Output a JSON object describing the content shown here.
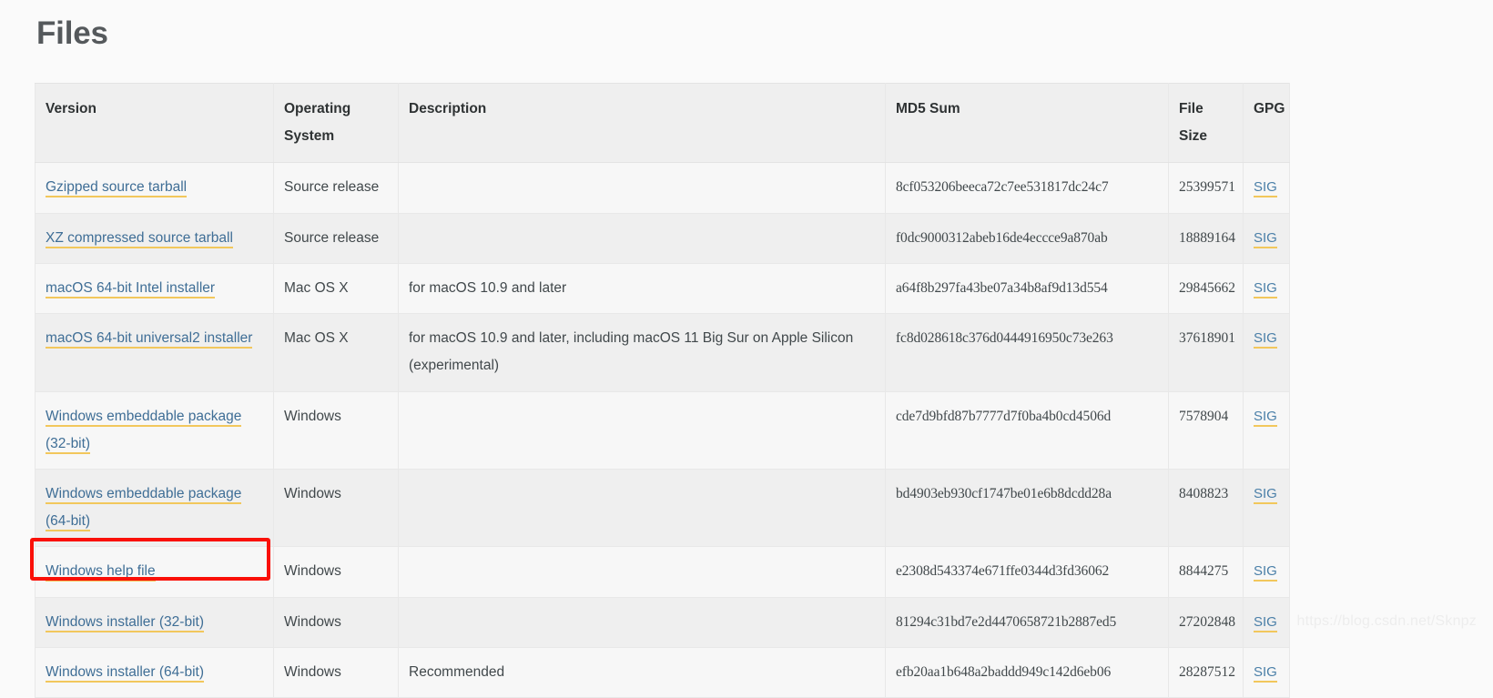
{
  "page": {
    "title": "Files",
    "watermark": "https://blog.csdn.net/Sknpz"
  },
  "table": {
    "headers": {
      "version": "Version",
      "os": "Operating System",
      "description": "Description",
      "md5": "MD5 Sum",
      "filesize": "File Size",
      "gpg": "GPG"
    },
    "rows": [
      {
        "version": "Gzipped source tarball",
        "os": "Source release",
        "description": "",
        "md5": "8cf053206beeca72c7ee531817dc24c7",
        "filesize": "25399571",
        "gpg": "SIG",
        "highlighted": false
      },
      {
        "version": "XZ compressed source tarball",
        "os": "Source release",
        "description": "",
        "md5": "f0dc9000312abeb16de4eccce9a870ab",
        "filesize": "18889164",
        "gpg": "SIG",
        "highlighted": false
      },
      {
        "version": "macOS 64-bit Intel installer",
        "os": "Mac OS X",
        "description": "for macOS 10.9 and later",
        "md5": "a64f8b297fa43be07a34b8af9d13d554",
        "filesize": "29845662",
        "gpg": "SIG",
        "highlighted": false
      },
      {
        "version": "macOS 64-bit universal2 installer",
        "os": "Mac OS X",
        "description": "for macOS 10.9 and later, including macOS 11 Big Sur on Apple Silicon (experimental)",
        "md5": "fc8d028618c376d0444916950c73e263",
        "filesize": "37618901",
        "gpg": "SIG",
        "highlighted": false
      },
      {
        "version": "Windows embeddable package (32-bit)",
        "os": "Windows",
        "description": "",
        "md5": "cde7d9bfd87b7777d7f0ba4b0cd4506d",
        "filesize": "7578904",
        "gpg": "SIG",
        "highlighted": false
      },
      {
        "version": "Windows embeddable package (64-bit)",
        "os": "Windows",
        "description": "",
        "md5": "bd4903eb930cf1747be01e6b8dcdd28a",
        "filesize": "8408823",
        "gpg": "SIG",
        "highlighted": false
      },
      {
        "version": "Windows help file",
        "os": "Windows",
        "description": "",
        "md5": "e2308d543374e671ffe0344d3fd36062",
        "filesize": "8844275",
        "gpg": "SIG",
        "highlighted": false
      },
      {
        "version": "Windows installer (32-bit)",
        "os": "Windows",
        "description": "",
        "md5": "81294c31bd7e2d4470658721b2887ed5",
        "filesize": "27202848",
        "gpg": "SIG",
        "highlighted": false
      },
      {
        "version": "Windows installer (64-bit)",
        "os": "Windows",
        "description": "Recommended",
        "md5": "efb20aa1b648a2baddd949c142d6eb06",
        "filesize": "28287512",
        "gpg": "SIG",
        "highlighted": true
      }
    ]
  },
  "colors": {
    "link": "#3f6e96",
    "link_underline": "#f2c75c",
    "header_bg": "#efefef",
    "row_odd_bg": "#f7f7f7",
    "row_even_bg": "#efefef",
    "highlight_border": "#fa1008",
    "page_bg": "#fafafa",
    "title": "#55595c"
  }
}
